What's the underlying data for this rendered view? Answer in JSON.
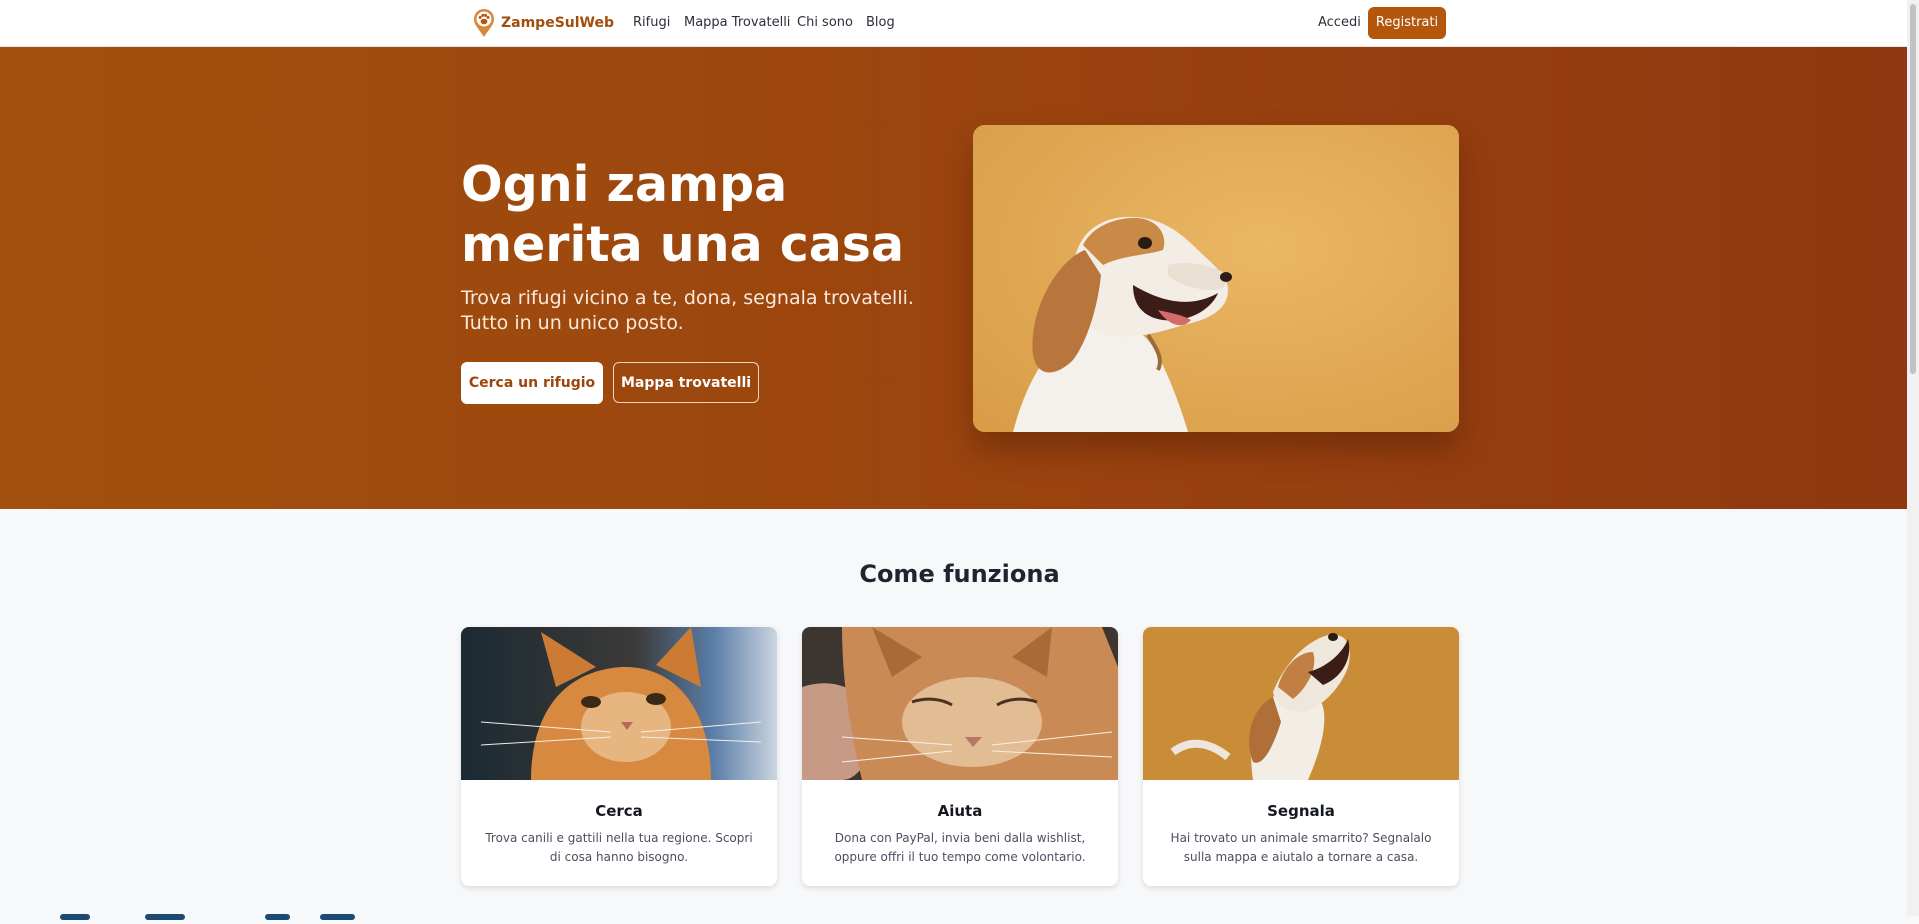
{
  "nav": {
    "brand": "ZampeSulWeb",
    "links": [
      "Rifugi",
      "Mappa Trovatelli",
      "Chi sono",
      "Blog"
    ],
    "login_label": "Accedi",
    "register_label": "Registrati"
  },
  "hero": {
    "title": "Ogni zampa merita una casa",
    "subtitle": "Trova rifugi vicino a te, dona, segnala trovatelli. Tutto in un unico posto.",
    "primary_button": "Cerca un rifugio",
    "secondary_button": "Mappa trovatelli"
  },
  "how_it_works": {
    "title": "Come funziona",
    "cards": [
      {
        "title": "Cerca",
        "text": "Trova canili e gattili nella tua regione. Scopri di cosa hanno bisogno."
      },
      {
        "title": "Aiuta",
        "text": "Dona con PayPal, invia beni dalla wishlist, oppure offri il tuo tempo come volontario."
      },
      {
        "title": "Segnala",
        "text": "Hai trovato un animale smarrito? Segnalalo sulla mappa e aiutalo a tornare a casa."
      }
    ]
  },
  "colors": {
    "brand": "#b4560c",
    "hero_start": "#a2500d",
    "hero_end": "#8f3811"
  }
}
